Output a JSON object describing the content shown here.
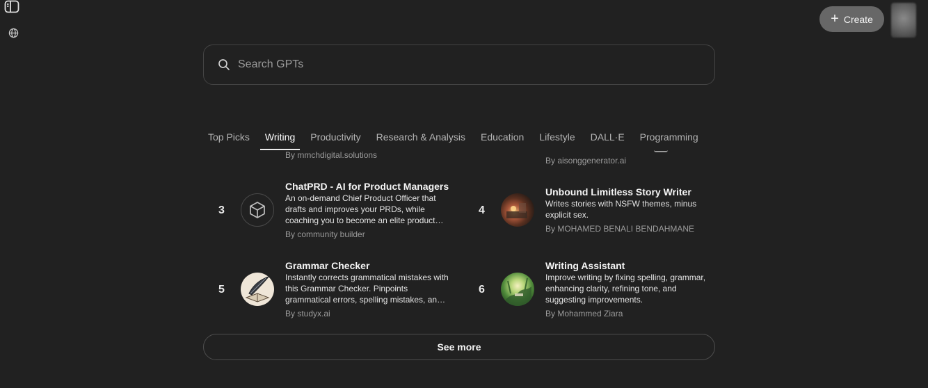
{
  "header": {
    "create_label": "Create"
  },
  "search": {
    "placeholder": "Search GPTs"
  },
  "tabs": [
    {
      "label": "Top Picks",
      "active": false
    },
    {
      "label": "Writing",
      "active": true
    },
    {
      "label": "Productivity",
      "active": false
    },
    {
      "label": "Research & Analysis",
      "active": false
    },
    {
      "label": "Education",
      "active": false
    },
    {
      "label": "Lifestyle",
      "active": false
    },
    {
      "label": "DALL·E",
      "active": false
    },
    {
      "label": "Programming",
      "active": false
    }
  ],
  "partial_items": {
    "left_author": "By mmchdigital.solutions",
    "right_author": "By aisonggenerator.ai"
  },
  "items": [
    {
      "rank": "3",
      "title": "ChatPRD - AI for Product Managers",
      "description": "An on-demand Chief Product Officer that drafts and improves your PRDs, while coaching you to become an elite product manager.",
      "author": "By community builder",
      "icon": "cube-icon"
    },
    {
      "rank": "4",
      "title": "Unbound Limitless Story Writer",
      "description": "Writes stories with NSFW themes, minus explicit sex.",
      "author": "By MOHAMED BENALI BENDAHMANE",
      "icon": "story-image"
    },
    {
      "rank": "5",
      "title": "Grammar Checker",
      "description": "Instantly corrects grammatical mistakes with this Grammar Checker. Pinpoints grammatical errors, spelling mistakes, and punctuation issues.",
      "author": "By studyx.ai",
      "icon": "quill-book-image"
    },
    {
      "rank": "6",
      "title": "Writing Assistant",
      "description": "Improve writing by fixing spelling, grammar, enhancing clarity, refining tone, and suggesting improvements.",
      "author": "By Mohammed Ziara",
      "icon": "forest-image"
    }
  ],
  "see_more_label": "See more"
}
